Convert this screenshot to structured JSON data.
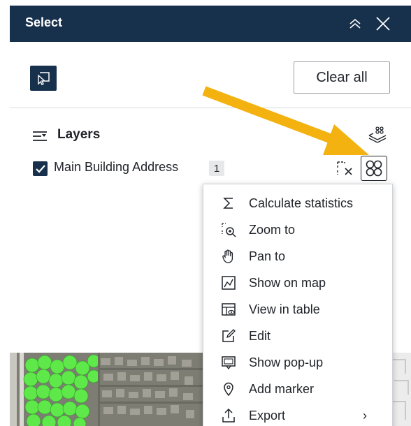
{
  "header": {
    "title": "Select"
  },
  "toolbar": {
    "clear_all_label": "Clear all"
  },
  "layers": {
    "heading": "Layers",
    "items": [
      {
        "name": "Main Building Address",
        "count": "1",
        "checked": true
      }
    ]
  },
  "actions_menu": {
    "items": [
      {
        "label": "Calculate statistics",
        "icon": "sigma-icon"
      },
      {
        "label": "Zoom to",
        "icon": "zoom-to-icon"
      },
      {
        "label": "Pan to",
        "icon": "hand-icon"
      },
      {
        "label": "Show on map",
        "icon": "show-on-map-icon"
      },
      {
        "label": "View in table",
        "icon": "view-table-icon"
      },
      {
        "label": "Edit",
        "icon": "edit-icon"
      },
      {
        "label": "Show pop-up",
        "icon": "popup-icon"
      },
      {
        "label": "Add marker",
        "icon": "marker-icon"
      },
      {
        "label": "Export",
        "icon": "export-icon",
        "has_submenu": true
      }
    ]
  },
  "colors": {
    "header_bg": "#17304c",
    "annotation_arrow": "#f3b20f",
    "selection_fill": "#5ee84a"
  }
}
